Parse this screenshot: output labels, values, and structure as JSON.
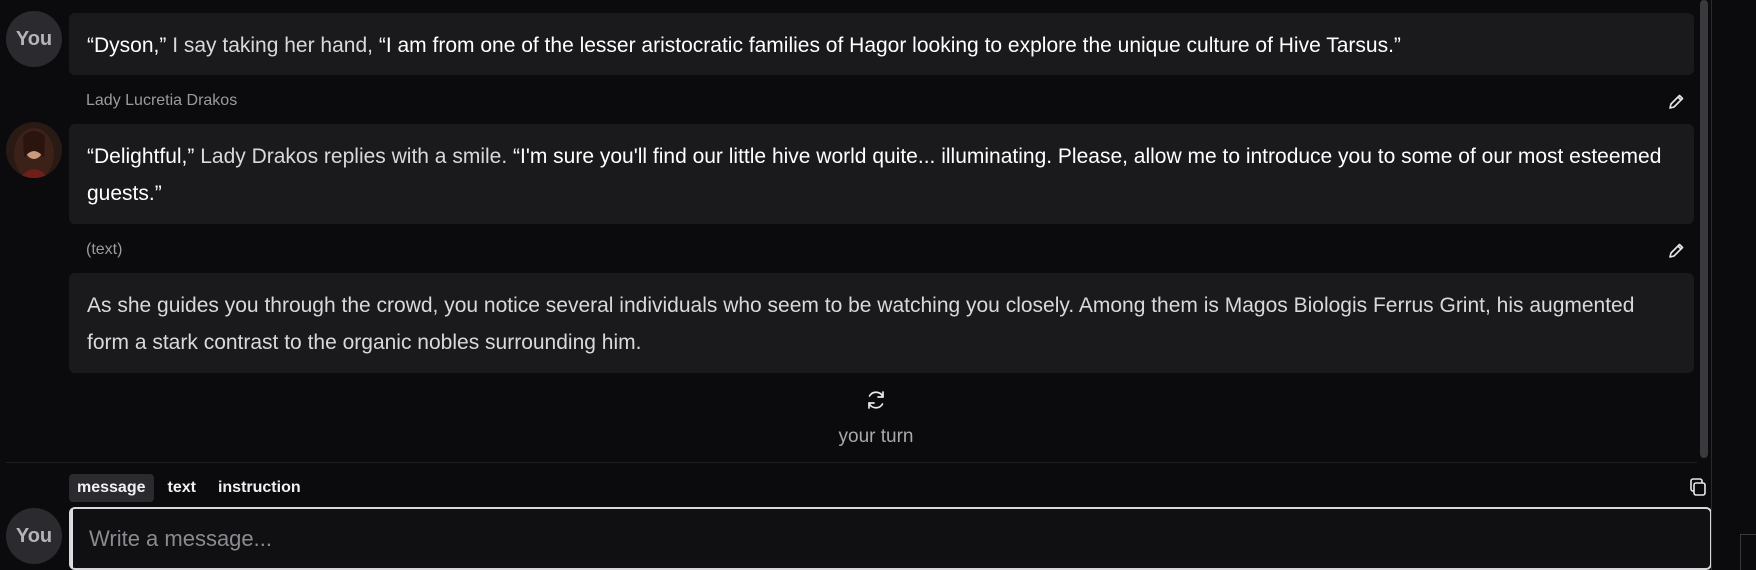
{
  "conversation": {
    "user_avatar_label": "You",
    "message1": {
      "quote1": "“Dyson,”",
      "narration": " I say taking her hand, ",
      "quote2": "“I am from one of the lesser aristocratic families of Hagor looking to explore the unique culture of Hive Tarsus.”"
    },
    "message2": {
      "sender": "Lady Lucretia Drakos",
      "quote1": "“Delightful,”",
      "narration": " Lady Drakos replies with a smile. ",
      "quote2": "“I'm sure you'll find our little hive world quite... illuminating. Please, allow me to introduce you to some of our most esteemed guests.”"
    },
    "message3": {
      "sender": "(text)",
      "body": "As she guides you through the crowd, you notice several individuals who seem to be watching you closely. Among them is Magos Biologis Ferrus Grint, his augmented form a stark contrast to the organic nobles surrounding him."
    },
    "turn_indicator": "your turn"
  },
  "composer": {
    "modes": [
      "message",
      "text",
      "instruction"
    ],
    "active_mode": "message",
    "avatar_label": "You",
    "placeholder": "Write a message...",
    "value": ""
  },
  "icons": {
    "edit": "pencil-icon",
    "regenerate": "refresh-icon",
    "copy": "copy-icon"
  },
  "colors": {
    "background": "#0b0b0d",
    "bubble": "#1a1a1d",
    "quote_text": "#ffffff",
    "narration_text": "#d9d9dc",
    "muted": "#9a9aa0"
  }
}
